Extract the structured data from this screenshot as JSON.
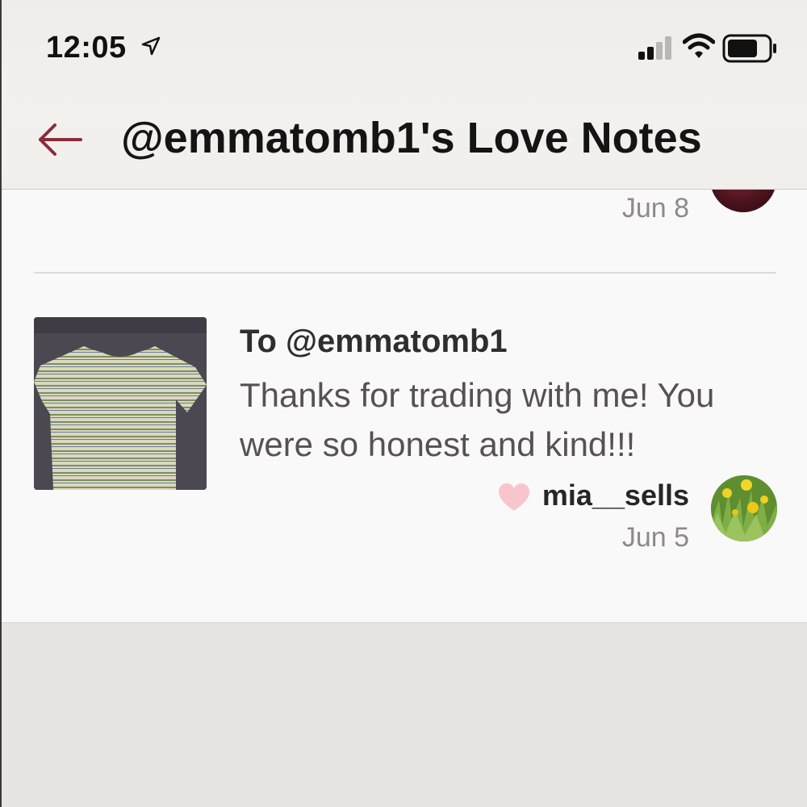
{
  "status_bar": {
    "time": "12:05",
    "location_icon": "location-arrow-icon",
    "signal_icon": "cellular-signal-icon",
    "wifi_icon": "wifi-icon",
    "battery_icon": "battery-icon"
  },
  "header": {
    "back_icon": "left-arrow-icon",
    "title": "@emmatomb1's Love Notes"
  },
  "previous_note": {
    "date": "Jun 8"
  },
  "note": {
    "to": "To @emmatomb1",
    "message": "Thanks for trading with me! You were so honest and kind!!!",
    "sender": "mia__sells",
    "date": "Jun 5",
    "heart_icon": "heart-icon"
  },
  "colors": {
    "accent": "#8b2c3a",
    "heart": "#f6c6cc",
    "muted_text": "#8e8a88",
    "background": "#e7e5e1"
  }
}
